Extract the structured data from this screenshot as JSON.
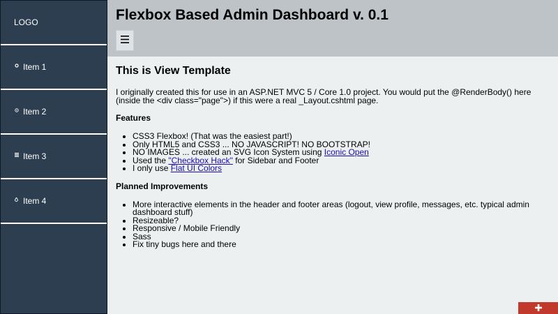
{
  "sidebar": {
    "logo": "LOGO",
    "items": [
      {
        "label": "Item 1",
        "icon": "circle-icon"
      },
      {
        "label": "Item 2",
        "icon": "target-icon"
      },
      {
        "label": "Item 3",
        "icon": "list-icon"
      },
      {
        "label": "Item 4",
        "icon": "droplet-icon"
      }
    ]
  },
  "header": {
    "title": "Flexbox Based Admin Dashboard v. 0.1",
    "menu_icon": "hamburger-icon"
  },
  "main": {
    "heading": "This is View Template",
    "intro": "I originally created this for use in an ASP.NET MVC 5 / Core 1.0 project. You would put the @RenderBody() here (inside the <div class=\"page\">) if this were a real _Layout.cshtml page.",
    "features_heading": "Features",
    "features": {
      "f1": "CSS3 Flexbox! (That was the easiest part!)",
      "f2": "Only HTML5 and CSS3 ... NO JAVASCRIPT! NO BOOTSTRAP!",
      "f3_text": "NO IMAGES ... created an SVG Icon System using ",
      "f3_link": "Iconic Open",
      "f4_pre": "Used the ",
      "f4_link": "\"Checkbox Hack\"",
      "f4_post": " for Sidebar and Footer",
      "f5_text": "I only use ",
      "f5_link": "Flat UI Colors"
    },
    "planned_heading": "Planned Improvements",
    "planned": [
      "More interactive elements in the header and footer areas (logout, view profile, messages, etc. typical admin dashboard stuff)",
      "Resizeable?",
      "Responsive / Mobile Friendly",
      "Sass",
      "Fix tiny bugs here and there"
    ]
  },
  "footer": {
    "toggle_icon": "plus-icon"
  },
  "colors": {
    "sidebar_bg": "#2c3e50",
    "header_bg": "#bdc3c7",
    "content_bg": "#ecf0f1",
    "footer_button": "#c0392b"
  }
}
